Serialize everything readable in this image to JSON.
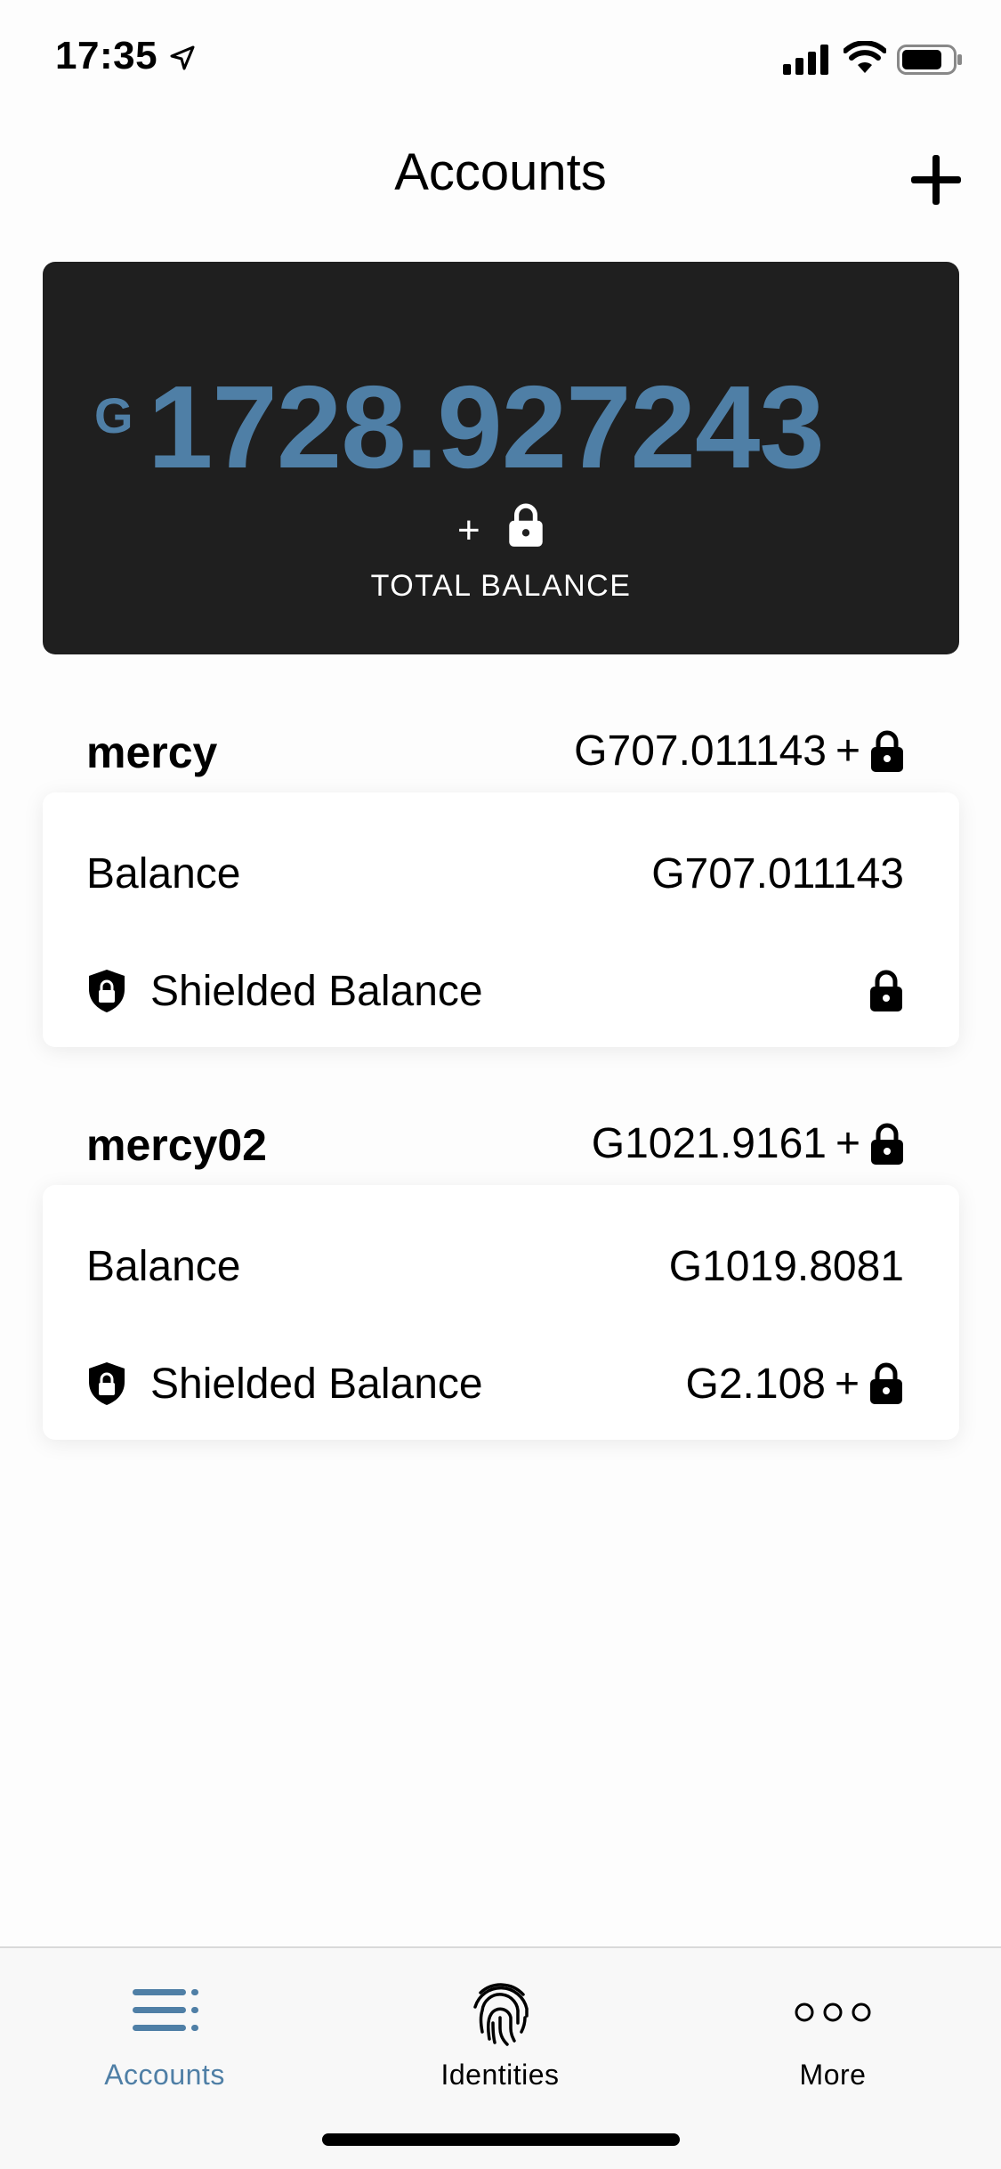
{
  "status_bar": {
    "time": "17:35"
  },
  "nav": {
    "title": "Accounts"
  },
  "total": {
    "currency_symbol": "G",
    "amount": "1728.927243",
    "plus": "+",
    "label": "TOTAL BALANCE"
  },
  "accounts": [
    {
      "name": "mercy",
      "total": "G707.011143",
      "total_plus": "+",
      "balance_label": "Balance",
      "balance_value": "G707.011143",
      "shielded_label": "Shielded Balance",
      "shielded_value": "",
      "shielded_plus": ""
    },
    {
      "name": "mercy02",
      "total": "G1021.9161",
      "total_plus": "+",
      "balance_label": "Balance",
      "balance_value": "G1019.8081",
      "shielded_label": "Shielded Balance",
      "shielded_value": "G2.108",
      "shielded_plus": "+"
    }
  ],
  "tabs": [
    {
      "label": "Accounts",
      "icon": "accounts-list-icon",
      "active": true
    },
    {
      "label": "Identities",
      "icon": "fingerprint-icon",
      "active": false
    },
    {
      "label": "More",
      "icon": "more-dots-icon",
      "active": false
    }
  ],
  "colors": {
    "accent": "#4f7fa6",
    "card_dark": "#1f1f1f"
  }
}
